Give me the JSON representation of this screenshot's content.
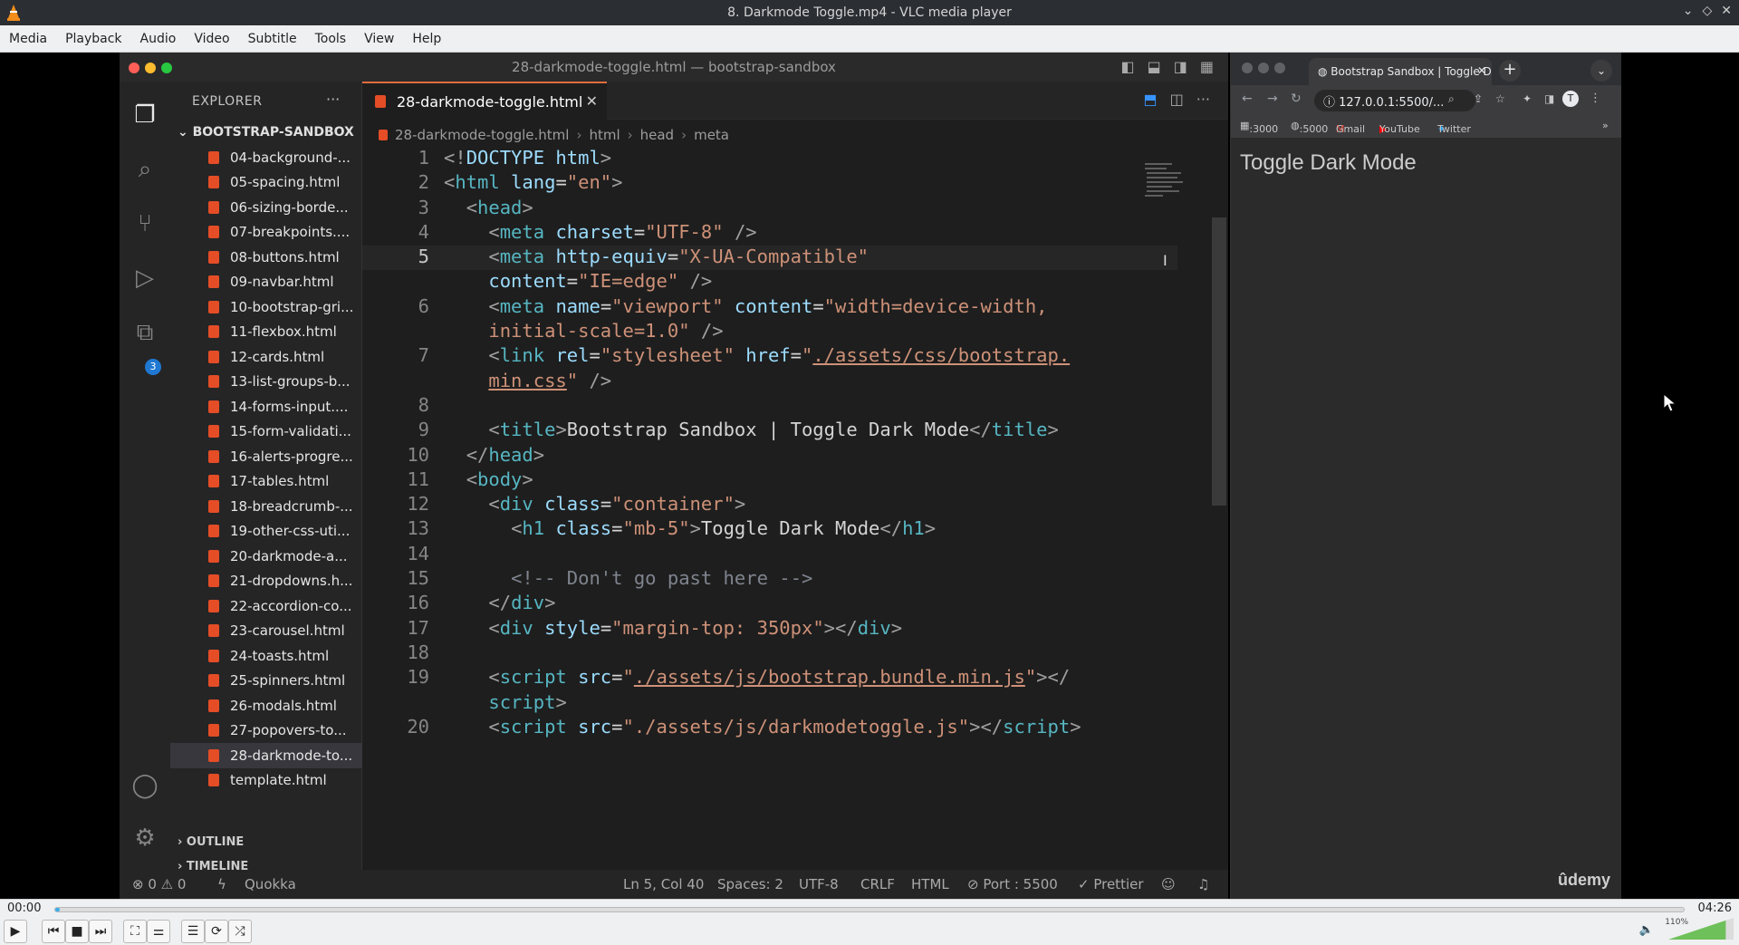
{
  "vlc": {
    "window_title": "8. Darkmode Toggle.mp4 - VLC media player",
    "menu": [
      "Media",
      "Playback",
      "Audio",
      "Video",
      "Subtitle",
      "Tools",
      "View",
      "Help"
    ],
    "time_current": "00:00",
    "time_total": "04:26",
    "progress_fraction": 0.003,
    "volume_label": "110%",
    "volume_fraction": 1.1
  },
  "vscode": {
    "window_title": "28-darkmode-toggle.html — bootstrap-sandbox",
    "explorer_title": "EXPLORER",
    "explorer_more": "···",
    "project_name": "BOOTSTRAP-SANDBOX",
    "extensions_badge": "3",
    "files": [
      "04-background-...",
      "05-spacing.html",
      "06-sizing-borde...",
      "07-breakpoints....",
      "08-buttons.html",
      "09-navbar.html",
      "10-bootstrap-gri...",
      "11-flexbox.html",
      "12-cards.html",
      "13-list-groups-b...",
      "14-forms-input....",
      "15-form-validati...",
      "16-alerts-progre...",
      "17-tables.html",
      "18-breadcrumb-...",
      "19-other-css-uti...",
      "20-darkmode-a...",
      "21-dropdowns.h...",
      "22-accordion-co...",
      "23-carousel.html",
      "24-toasts.html",
      "25-spinners.html",
      "26-modals.html",
      "27-popovers-to...",
      "28-darkmode-to...",
      "template.html"
    ],
    "selected_file_index": 24,
    "outline_label": "OUTLINE",
    "timeline_label": "TIMELINE",
    "active_tab": "28-darkmode-toggle.html",
    "breadcrumb": [
      "28-darkmode-toggle.html",
      "html",
      "head",
      "meta"
    ],
    "line_numbers": [
      "1",
      "2",
      "3",
      "4",
      "5",
      "",
      "6",
      "",
      "7",
      "",
      "8",
      "9",
      "10",
      "11",
      "12",
      "13",
      "14",
      "15",
      "16",
      "17",
      "18",
      "19",
      "",
      "20"
    ],
    "current_line": "5",
    "status": {
      "problems": "⊗ 0 ⚠ 0",
      "user": "Quokka",
      "cursor": "Ln 5, Col 40",
      "spaces": "Spaces: 2",
      "encoding": "UTF-8",
      "eol": "CRLF",
      "language": "HTML",
      "port": "⊘ Port : 5500",
      "prettier": "✓ Prettier"
    }
  },
  "browser": {
    "tab_title": "Bootstrap Sandbox | Toggle Da",
    "url": "127.0.0.1:5500/...",
    "bookmarks": [
      ":3000",
      ":5000",
      "Gmail",
      "YouTube",
      "Twitter"
    ],
    "page_heading": "Toggle Dark Mode",
    "watermark": "ûdemy"
  },
  "colors": {
    "html_icon": "#e44d26",
    "tab_accent": "#e06c3c",
    "seek_fill": "#3daee9"
  }
}
